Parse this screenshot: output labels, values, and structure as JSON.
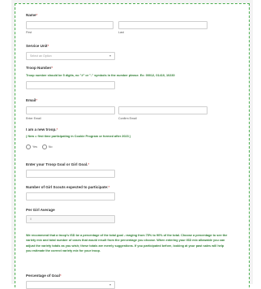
{
  "form": {
    "name": {
      "label": "Name",
      "first": "First",
      "last": "Last"
    },
    "service_unit": {
      "label": "Service Unit",
      "placeholder": "Select an Option"
    },
    "troop_number": {
      "label": "Troop Number",
      "hint": "Troop number should be 5 digits, no \"#\" or \"-\" symbols in the number please. Ex: 00012, 01410, 10230"
    },
    "email": {
      "label": "Email",
      "enter": "Enter Email",
      "confirm": "Confirm Email"
    },
    "new_troop": {
      "label": "I am a new troop.",
      "hint": "( New = first time participating in Cookie Program or formed after 2023 )",
      "yes": "Yes",
      "no": "No"
    },
    "goal": {
      "label": "Enter your Troop Goal or Girl Goal."
    },
    "girls": {
      "label": "Number of Girl Scouts expected to participate:"
    },
    "per_girl": {
      "label": "Per Girl Average",
      "value": "0"
    },
    "recommend": "We recommend that a troop's ISD be a percentage of the total goal - ranging from 75% to 90% of the total. Choose a percentage to see the variety mix and total number of cases that would result from the percentage you choose. When entering your ISD mix allowable you can adjust the variety totals as you wish; these totals are merely suggestions. If you participated before, looking at your past sales will help you estimate the correct variety mix for your troop.",
    "percentage": {
      "label": "Percentage of Goal"
    },
    "required_mark": "*"
  }
}
